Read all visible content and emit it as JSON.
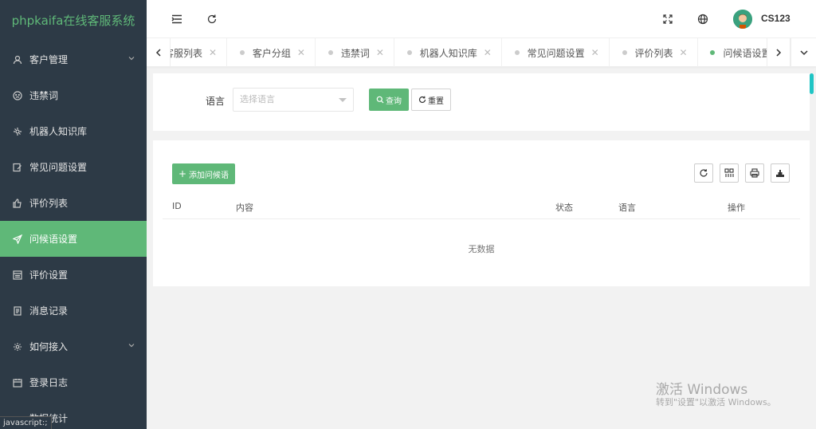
{
  "app": {
    "title": "phpkaifa在线客服系统"
  },
  "sidebar": {
    "items": [
      {
        "label": "客户管理",
        "icon": "user-icon",
        "expandable": true
      },
      {
        "label": "违禁词",
        "icon": "face-icon"
      },
      {
        "label": "机器人知识库",
        "icon": "robot-icon"
      },
      {
        "label": "常见问题设置",
        "icon": "edit-icon"
      },
      {
        "label": "评价列表",
        "icon": "thumbs-up-icon"
      },
      {
        "label": "问候语设置",
        "icon": "send-icon",
        "active": true
      },
      {
        "label": "评价设置",
        "icon": "form-icon"
      },
      {
        "label": "消息记录",
        "icon": "log-icon"
      },
      {
        "label": "如何接入",
        "icon": "gear-icon",
        "expandable": true
      },
      {
        "label": "登录日志",
        "icon": "calendar-icon"
      },
      {
        "label": "数据统计",
        "icon": "link-icon"
      }
    ]
  },
  "status_bar": {
    "text": "javascript:;"
  },
  "header": {
    "username": "CS123"
  },
  "tabs": [
    {
      "label": "客服列表"
    },
    {
      "label": "客户分组"
    },
    {
      "label": "违禁词"
    },
    {
      "label": "机器人知识库"
    },
    {
      "label": "常见问题设置"
    },
    {
      "label": "评价列表"
    },
    {
      "label": "问候语设置",
      "active": true
    }
  ],
  "search": {
    "language_label": "语言",
    "language_placeholder": "选择语言",
    "query_label": "查询",
    "reset_label": "重置"
  },
  "table": {
    "add_label": "添加问候语",
    "columns": [
      "ID",
      "内容",
      "状态",
      "语言",
      "操作"
    ],
    "empty_text": "无数据",
    "rows": []
  },
  "watermark": {
    "line1": "激活 Windows",
    "line2": "转到\"设置\"以激活 Windows。"
  },
  "colors": {
    "accent": "#5fb878",
    "sidebar_bg": "#2d3a46"
  }
}
